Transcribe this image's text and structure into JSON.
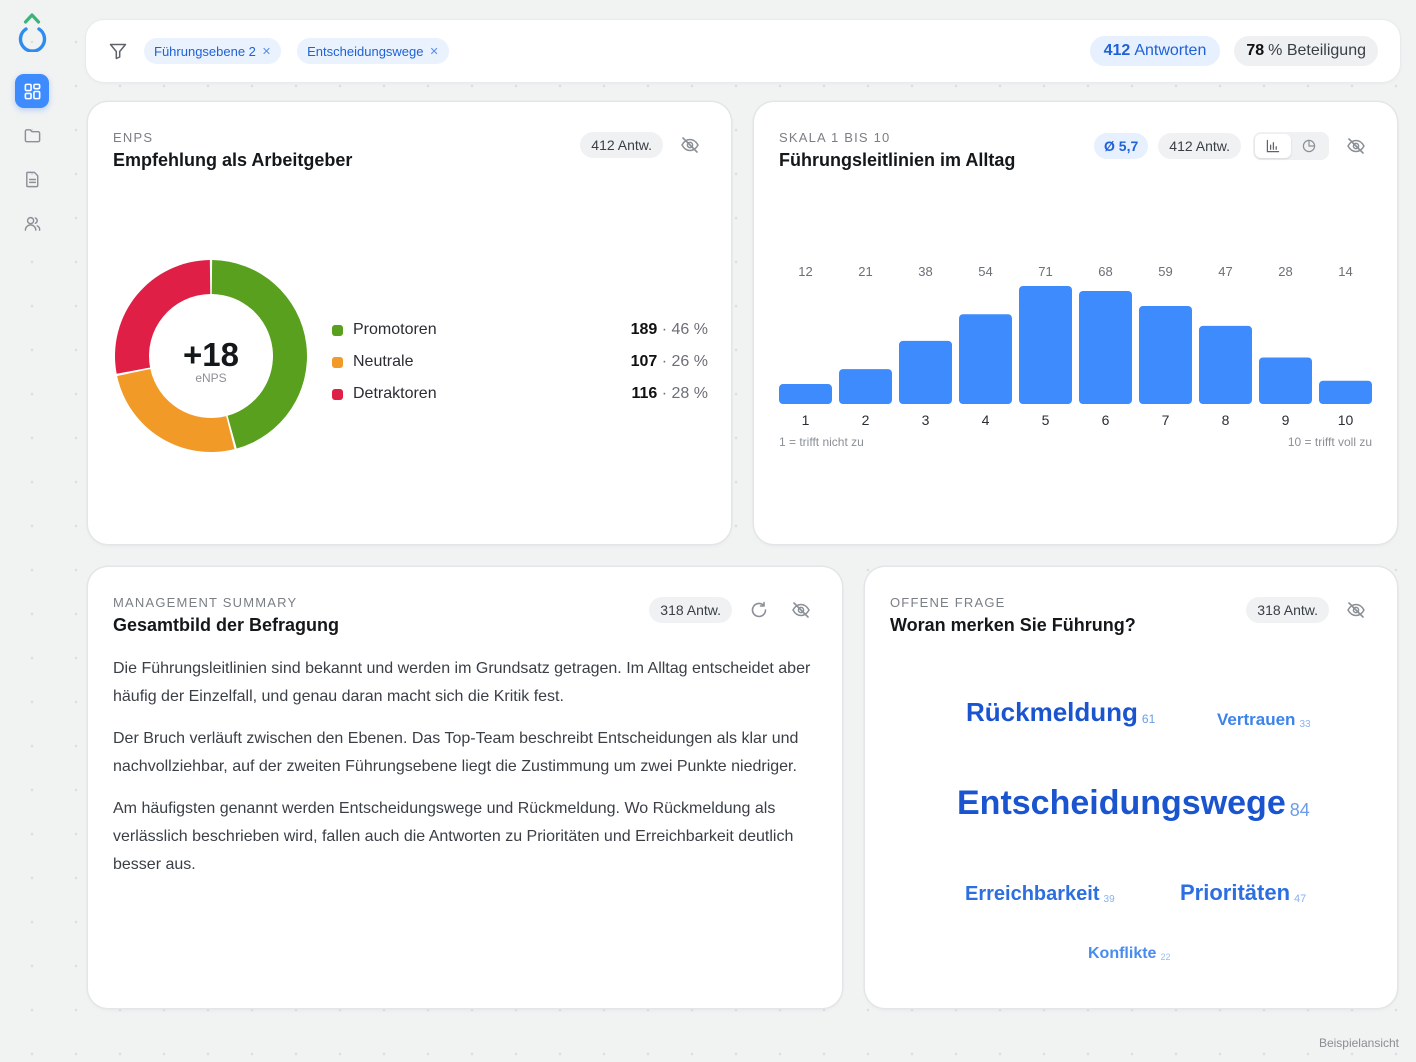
{
  "filters": {
    "chips": [
      {
        "label": "Führungsebene 2"
      },
      {
        "label": "Entscheidungswege"
      }
    ],
    "responses_count": "412",
    "responses_label": "Antworten",
    "participation_value": "78",
    "participation_label": "% Beteiligung"
  },
  "enps_card": {
    "kicker": "eNPS",
    "title": "Empfehlung als Arbeitgeber",
    "count": "412 Antw.",
    "score": "+18",
    "score_label": "eNPS",
    "legend": [
      {
        "label": "Promotoren",
        "count": "189",
        "percent": "46 %",
        "color": "#58a01e"
      },
      {
        "label": "Neutrale",
        "count": "107",
        "percent": "26 %",
        "color": "#f29a28"
      },
      {
        "label": "Detraktoren",
        "count": "116",
        "percent": "28 %",
        "color": "#df1f45"
      }
    ],
    "chart_data": {
      "type": "pie",
      "categories": [
        "Promotoren",
        "Neutrale",
        "Detraktoren"
      ],
      "values": [
        189,
        107,
        116
      ],
      "colors": [
        "#58a01e",
        "#f29a28",
        "#df1f45"
      ]
    }
  },
  "scale_card": {
    "kicker": "Skala 1 bis 10",
    "title": "Führungsleitlinien im Alltag",
    "average": "Ø 5,7",
    "count": "412 Antw.",
    "min_label": "1 = trifft nicht zu",
    "max_label": "10 = trifft voll zu",
    "chart_data": {
      "type": "bar",
      "categories": [
        "1",
        "2",
        "3",
        "4",
        "5",
        "6",
        "7",
        "8",
        "9",
        "10"
      ],
      "values": [
        12,
        21,
        38,
        54,
        71,
        68,
        59,
        47,
        28,
        14
      ],
      "color": "#3d8bfd"
    }
  },
  "summary_card": {
    "kicker": "Management Summary",
    "title": "Gesamtbild der Befragung",
    "count": "318 Antw.",
    "paragraphs": [
      "Die Führungsleitlinien sind bekannt und werden im Grundsatz getragen. Im Alltag entscheidet aber häufig der Einzelfall, und genau daran macht sich die Kritik fest.",
      "Der Bruch verläuft zwischen den Ebenen. Das Top-Team beschreibt Entscheidungen als klar und nachvollziehbar, auf der zweiten Führungsebene liegt die Zustimmung um zwei Punkte niedriger.",
      "Am häufigsten genannt werden Entscheidungswege und Rückmeldung. Wo Rückmeldung als verlässlich beschrieben wird, fallen auch die Antworten zu Prioritäten und Erreichbarkeit deutlich besser aus."
    ]
  },
  "open_card": {
    "kicker": "Offene Frage",
    "title": "Woran merken Sie Führung?",
    "count": "318 Antw.",
    "words": [
      {
        "text": "Rückmeldung",
        "count": "61"
      },
      {
        "text": "Vertrauen",
        "count": "33"
      },
      {
        "text": "Entscheidungswege",
        "count": "84"
      },
      {
        "text": "Erreichbarkeit",
        "count": "39"
      },
      {
        "text": "Prioritäten",
        "count": "47"
      },
      {
        "text": "Konflikte",
        "count": "22"
      }
    ]
  },
  "footer_note": "Beispielansicht",
  "icons": {
    "logo": "drop-logo-icon",
    "nav": [
      "dashboard-icon",
      "folder-icon",
      "document-icon",
      "users-icon"
    ],
    "filter": "filter-icon",
    "hide": "eye-off-icon",
    "refresh": "refresh-icon",
    "bar_toggle": "bar-chart-icon",
    "pie_toggle": "pie-chart-icon"
  }
}
